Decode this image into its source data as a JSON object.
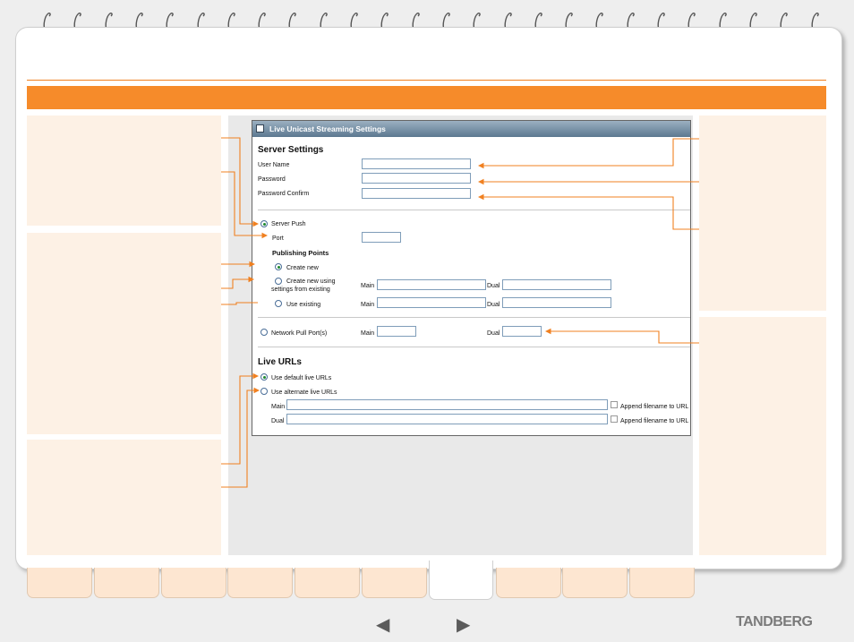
{
  "dialog": {
    "title": "Live Unicast Streaming Settings",
    "server_settings": {
      "heading": "Server Settings",
      "user_name_label": "User Name",
      "password_label": "Password",
      "password_confirm_label": "Password Confirm"
    },
    "server_push": {
      "label": "Server Push",
      "selected": true,
      "port_label": "Port"
    },
    "publishing_points": {
      "heading": "Publishing Points",
      "create_new_label": "Create new",
      "create_new_using_label_line1": "Create new using",
      "create_new_using_label_line2": "settings from existing",
      "use_existing_label": "Use existing",
      "main_label": "Main",
      "dual_label": "Dual"
    },
    "network_pull": {
      "label": "Network Pull Port(s)",
      "main_label": "Main",
      "dual_label": "Dual"
    },
    "live_urls": {
      "heading": "Live URLs",
      "use_default_label": "Use default live URLs",
      "use_alternate_label": "Use alternate live URLs",
      "main_label": "Main",
      "dual_label": "Dual",
      "append_label": "Append filename to URL"
    }
  },
  "navigation": {
    "prev_icon": "left-arrow-icon",
    "next_icon": "right-arrow-icon",
    "active_tab_index": 6,
    "tab_count": 10
  },
  "brand": {
    "logo_text": "TANDBERG",
    "accent_color": "#f68b2a",
    "panel_color": "#fdf1e5"
  }
}
